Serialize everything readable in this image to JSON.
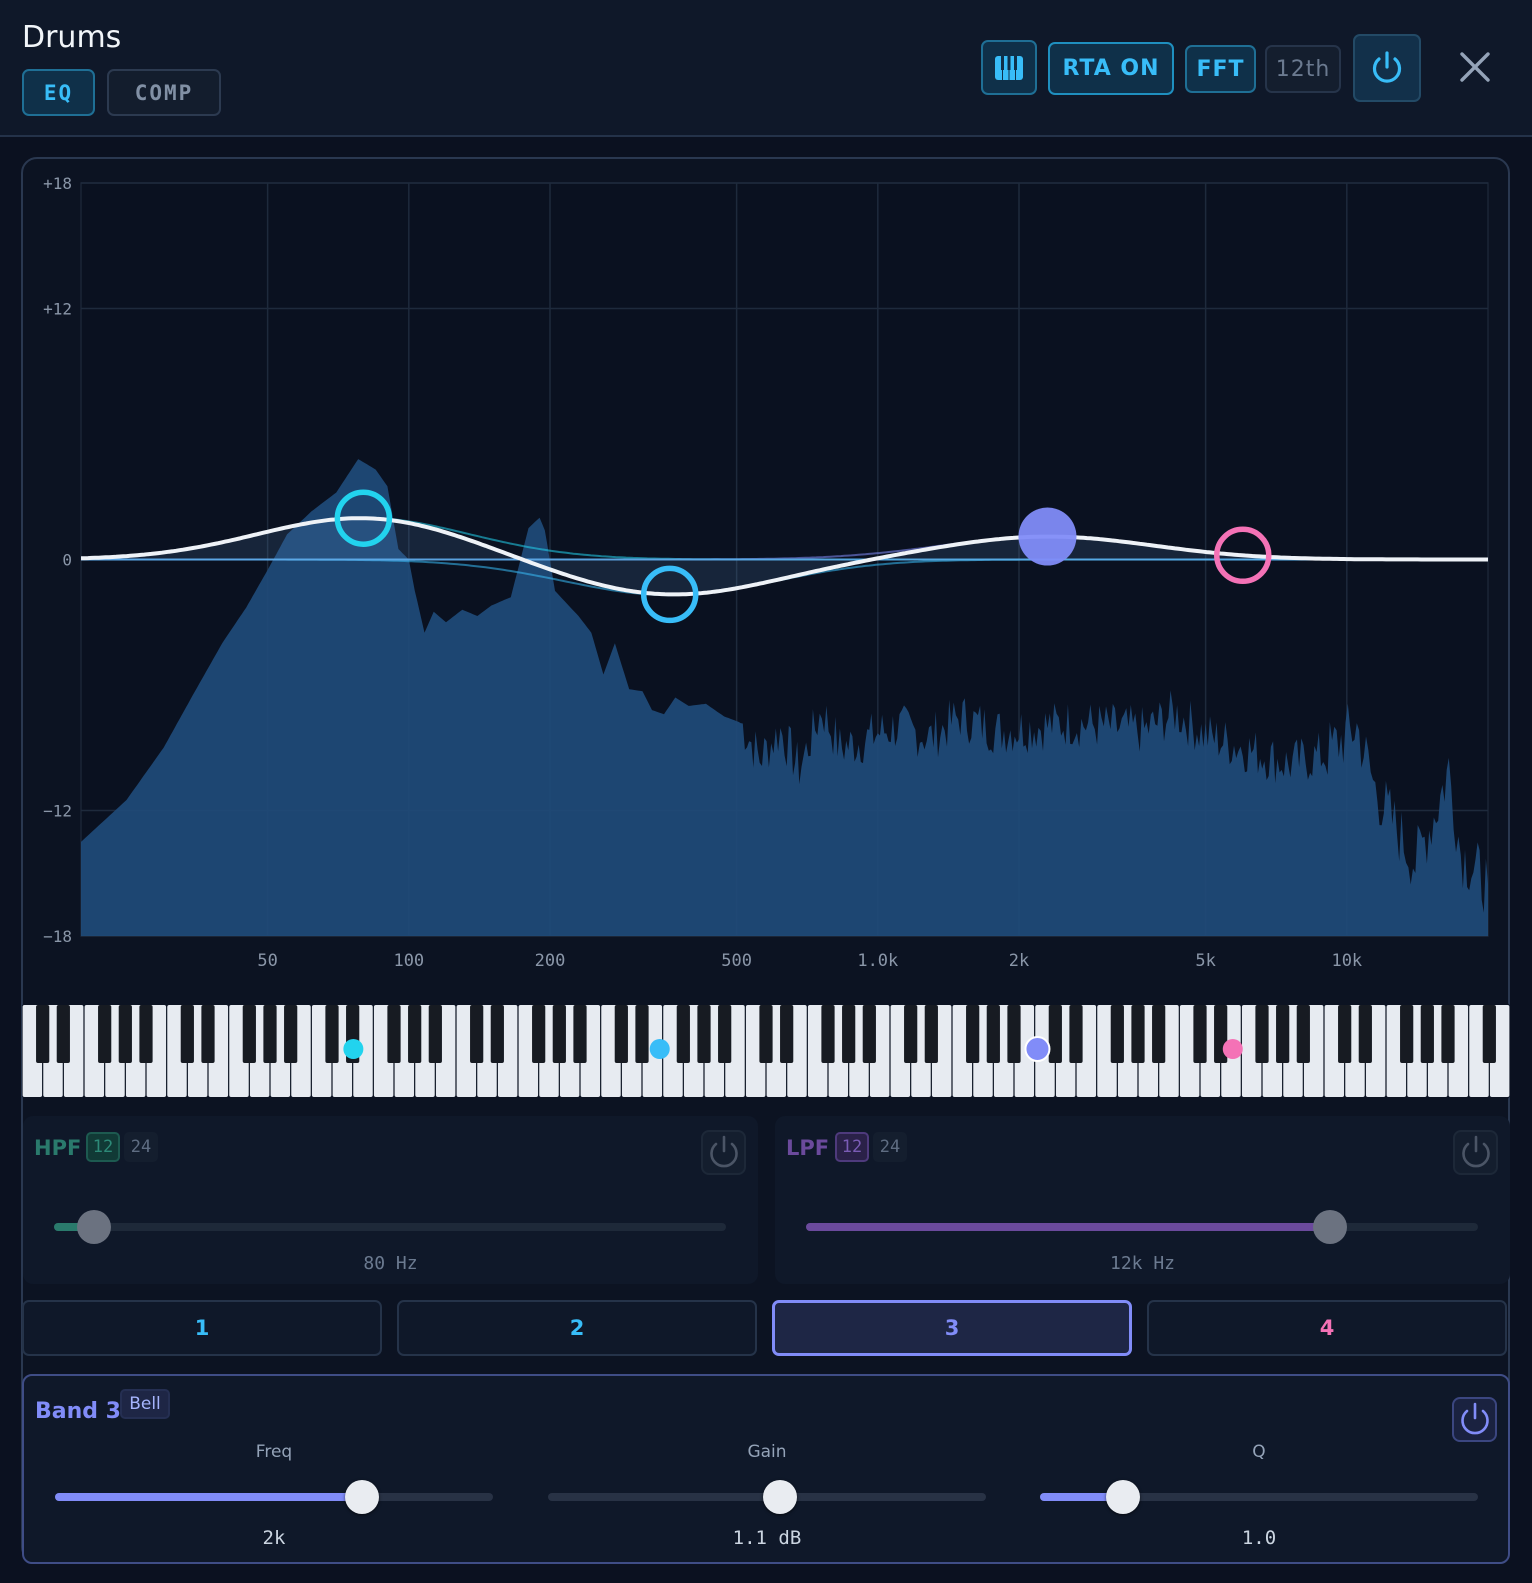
{
  "header": {
    "title": "Drums",
    "tabs": [
      {
        "label": "EQ",
        "active": true
      },
      {
        "label": "COMP",
        "active": false
      }
    ],
    "keyboard_icon": "piano-keys-icon",
    "rta_label": "RTA ON",
    "fft_label": "FFT",
    "resolution_label": "12th",
    "power_icon": "power-icon",
    "close_icon": "close-icon"
  },
  "chart_data": {
    "type": "area",
    "x_scale": "log",
    "x_tick_values": [
      50,
      100,
      200,
      500,
      1000,
      2000,
      5000,
      10000
    ],
    "x_tick_labels": [
      "50",
      "100",
      "200",
      "500",
      "1.0k",
      "2k",
      "5k",
      "10k"
    ],
    "y_ticks": [
      "+18",
      "+12",
      "0",
      "-12",
      "-18"
    ],
    "ylim": [
      -18,
      18
    ],
    "xlim": [
      20,
      20000
    ],
    "bands": [
      {
        "id": 1,
        "freq": 80,
        "gain": 2.0,
        "color": "#22d3ee",
        "filled": false
      },
      {
        "id": 2,
        "freq": 360,
        "gain": -1.7,
        "color": "#38bdf8",
        "filled": false
      },
      {
        "id": 3,
        "freq": 2300,
        "gain": 1.1,
        "color": "#818cf8",
        "filled": true
      },
      {
        "id": 4,
        "freq": 6000,
        "gain": 0.0,
        "color": "#f472b6",
        "filled": false
      }
    ],
    "spectrum": [
      [
        20,
        -13.5
      ],
      [
        25,
        -11.5
      ],
      [
        30,
        -9
      ],
      [
        35,
        -6.3
      ],
      [
        40,
        -4
      ],
      [
        45,
        -2.3
      ],
      [
        50,
        -0.5
      ],
      [
        55,
        1.2
      ],
      [
        62,
        2.3
      ],
      [
        70,
        3.2
      ],
      [
        78,
        4.8
      ],
      [
        85,
        4.3
      ],
      [
        90,
        3.5
      ],
      [
        95,
        0.5
      ],
      [
        100,
        0
      ],
      [
        103,
        -1.5
      ],
      [
        108,
        -3.5
      ],
      [
        113,
        -2.5
      ],
      [
        120,
        -3
      ],
      [
        130,
        -2.4
      ],
      [
        140,
        -2.7
      ],
      [
        150,
        -2.2
      ],
      [
        165,
        -1.8
      ],
      [
        180,
        1.5
      ],
      [
        190,
        2.0
      ],
      [
        195,
        1.4
      ],
      [
        205,
        -1.5
      ],
      [
        215,
        -2
      ],
      [
        230,
        -2.7
      ],
      [
        245,
        -3.5
      ],
      [
        260,
        -5.5
      ],
      [
        275,
        -4
      ],
      [
        295,
        -6.2
      ],
      [
        315,
        -6.3
      ],
      [
        330,
        -7.2
      ],
      [
        350,
        -7.4
      ],
      [
        370,
        -6.6
      ],
      [
        395,
        -7
      ],
      [
        430,
        -6.9
      ],
      [
        470,
        -7.5
      ],
      [
        510,
        -7.8
      ],
      [
        560,
        -9.5
      ],
      [
        620,
        -8.2
      ],
      [
        680,
        -10
      ],
      [
        760,
        -7.2
      ],
      [
        830,
        -9
      ],
      [
        920,
        -8.7
      ],
      [
        1000,
        -8.3
      ],
      [
        1100,
        -8
      ],
      [
        1300,
        -8.5
      ],
      [
        1500,
        -7.5
      ],
      [
        1800,
        -8.2
      ],
      [
        2200,
        -8
      ],
      [
        2600,
        -7.8
      ],
      [
        3100,
        -8
      ],
      [
        3700,
        -8.2
      ],
      [
        4300,
        -7.3
      ],
      [
        5000,
        -8.4
      ],
      [
        6000,
        -9
      ],
      [
        7500,
        -9.8
      ],
      [
        9000,
        -9.3
      ],
      [
        10500,
        -8
      ],
      [
        11500,
        -11
      ],
      [
        12500,
        -12.5
      ],
      [
        14000,
        -14.5
      ],
      [
        15500,
        -12
      ],
      [
        16500,
        -10
      ],
      [
        17500,
        -14
      ],
      [
        19000,
        -15
      ],
      [
        20000,
        -15.5
      ]
    ]
  },
  "keyboard": {
    "markers": [
      "#22d3ee",
      "#38bdf8",
      "#818cf8",
      "#f472b6"
    ]
  },
  "hpf": {
    "label": "HPF",
    "slopes": [
      "12",
      "24"
    ],
    "value": "80 Hz",
    "color": "#2a7a6c",
    "position": 0.06
  },
  "lpf": {
    "label": "LPF",
    "slopes": [
      "12",
      "24"
    ],
    "value": "12k Hz",
    "color": "#6b4a9c",
    "position": 0.78
  },
  "band_tabs": [
    "1",
    "2",
    "3",
    "4"
  ],
  "band": {
    "title": "Band 3",
    "type": "Bell",
    "params": [
      {
        "label": "Freq",
        "value": "2k",
        "position": 0.7,
        "fill": true
      },
      {
        "label": "Gain",
        "value": "1.1 dB",
        "position": 0.53,
        "fill": false
      },
      {
        "label": "Q",
        "value": "1.0",
        "position": 0.19,
        "fill": true
      }
    ]
  }
}
